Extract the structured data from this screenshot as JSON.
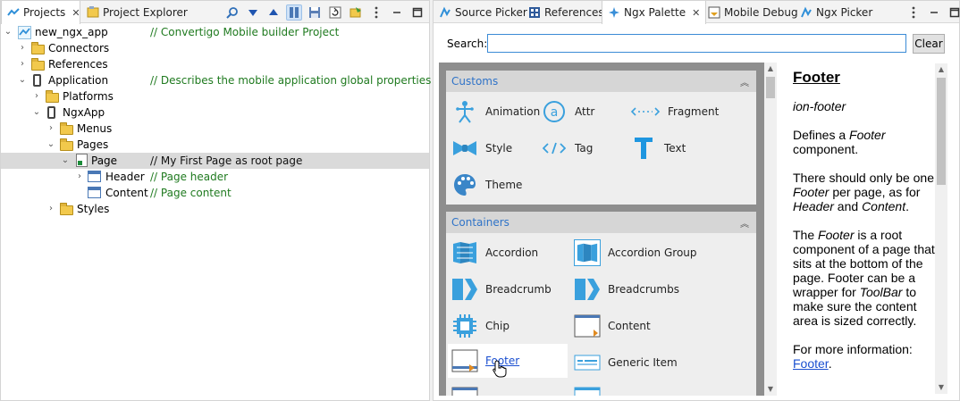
{
  "left_tabs": {
    "projects": "Projects",
    "project_explorer": "Project Explorer"
  },
  "tree": {
    "project": "new_ngx_app",
    "project_comment": "// Convertigo Mobile builder Project",
    "connectors": "Connectors",
    "references": "References",
    "application": "Application",
    "application_comment": "// Describes the mobile application global properties",
    "platforms": "Platforms",
    "ngxapp": "NgxApp",
    "menus": "Menus",
    "pages": "Pages",
    "page": "Page",
    "page_comment": "// My First Page as root page",
    "header": "Header",
    "header_comment": "// Page header",
    "content": "Content",
    "content_comment": "// Page content",
    "styles": "Styles"
  },
  "right_tabs": {
    "source_picker": "Source Picker",
    "references": "References",
    "ngx_palette": "Ngx Palette",
    "mobile_debug": "Mobile Debug",
    "ngx_picker": "Ngx Picker"
  },
  "search": {
    "label": "Search:",
    "value": "",
    "clear": "Clear"
  },
  "palette": {
    "customs": {
      "title": "Customs",
      "items": [
        "Animation",
        "Attr",
        "Fragment",
        "Style",
        "Tag",
        "Text",
        "Theme"
      ]
    },
    "containers": {
      "title": "Containers",
      "items": [
        "Accordion",
        "Accordion Group",
        "Breadcrumb",
        "Breadcrumbs",
        "Chip",
        "Content",
        "Footer",
        "Generic Item"
      ]
    }
  },
  "doc": {
    "title": "Footer",
    "tag": "ion-footer",
    "p1_a": "Defines a ",
    "p1_em": "Footer",
    "p1_b": " component.",
    "p2_a": "There should only be one ",
    "p2_em1": "Footer",
    "p2_b": " per page, as for ",
    "p2_em2": "Header",
    "p2_c": " and ",
    "p2_em3": "Content",
    "p2_d": ".",
    "p3_a": "The ",
    "p3_em1": "Footer",
    "p3_b": " is a root component of a page that sits at the bottom of the page. Footer can be a wrapper for ",
    "p3_em2": "ToolBar",
    "p3_c": " to make sure the content area is sized correctly.",
    "p4": "For more information:",
    "link": "Footer",
    "link_after": "."
  },
  "colors": {
    "accent": "#2f73c8",
    "comment": "#1f7a1f",
    "palette_bg": "#8e8e8e",
    "selection": "#dadada"
  }
}
